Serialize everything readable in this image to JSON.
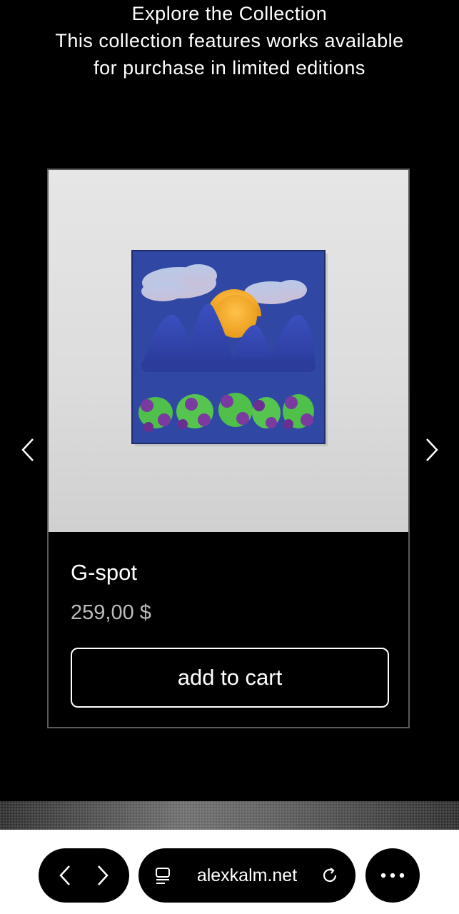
{
  "header": {
    "title": "Explore the Collection",
    "description": "This collection features works available for purchase in limited editions"
  },
  "product": {
    "name": "G-spot",
    "price": "259,00 $",
    "add_to_cart_label": "add to cart"
  },
  "carousel": {
    "prev_icon": "chevron-left-icon",
    "next_icon": "chevron-right-icon"
  },
  "browser": {
    "url": "alexkalm.net",
    "back_icon": "chevron-left-icon",
    "forward_icon": "chevron-right-icon",
    "reader_icon": "reader-mode-icon",
    "reload_icon": "reload-icon",
    "more_icon": "more-icon"
  },
  "colors": {
    "background": "#000000",
    "text": "#ffffff",
    "price": "#bdbdbd",
    "card_border": "#5a5a5a",
    "canvas_blue": "#2f4aa0"
  }
}
